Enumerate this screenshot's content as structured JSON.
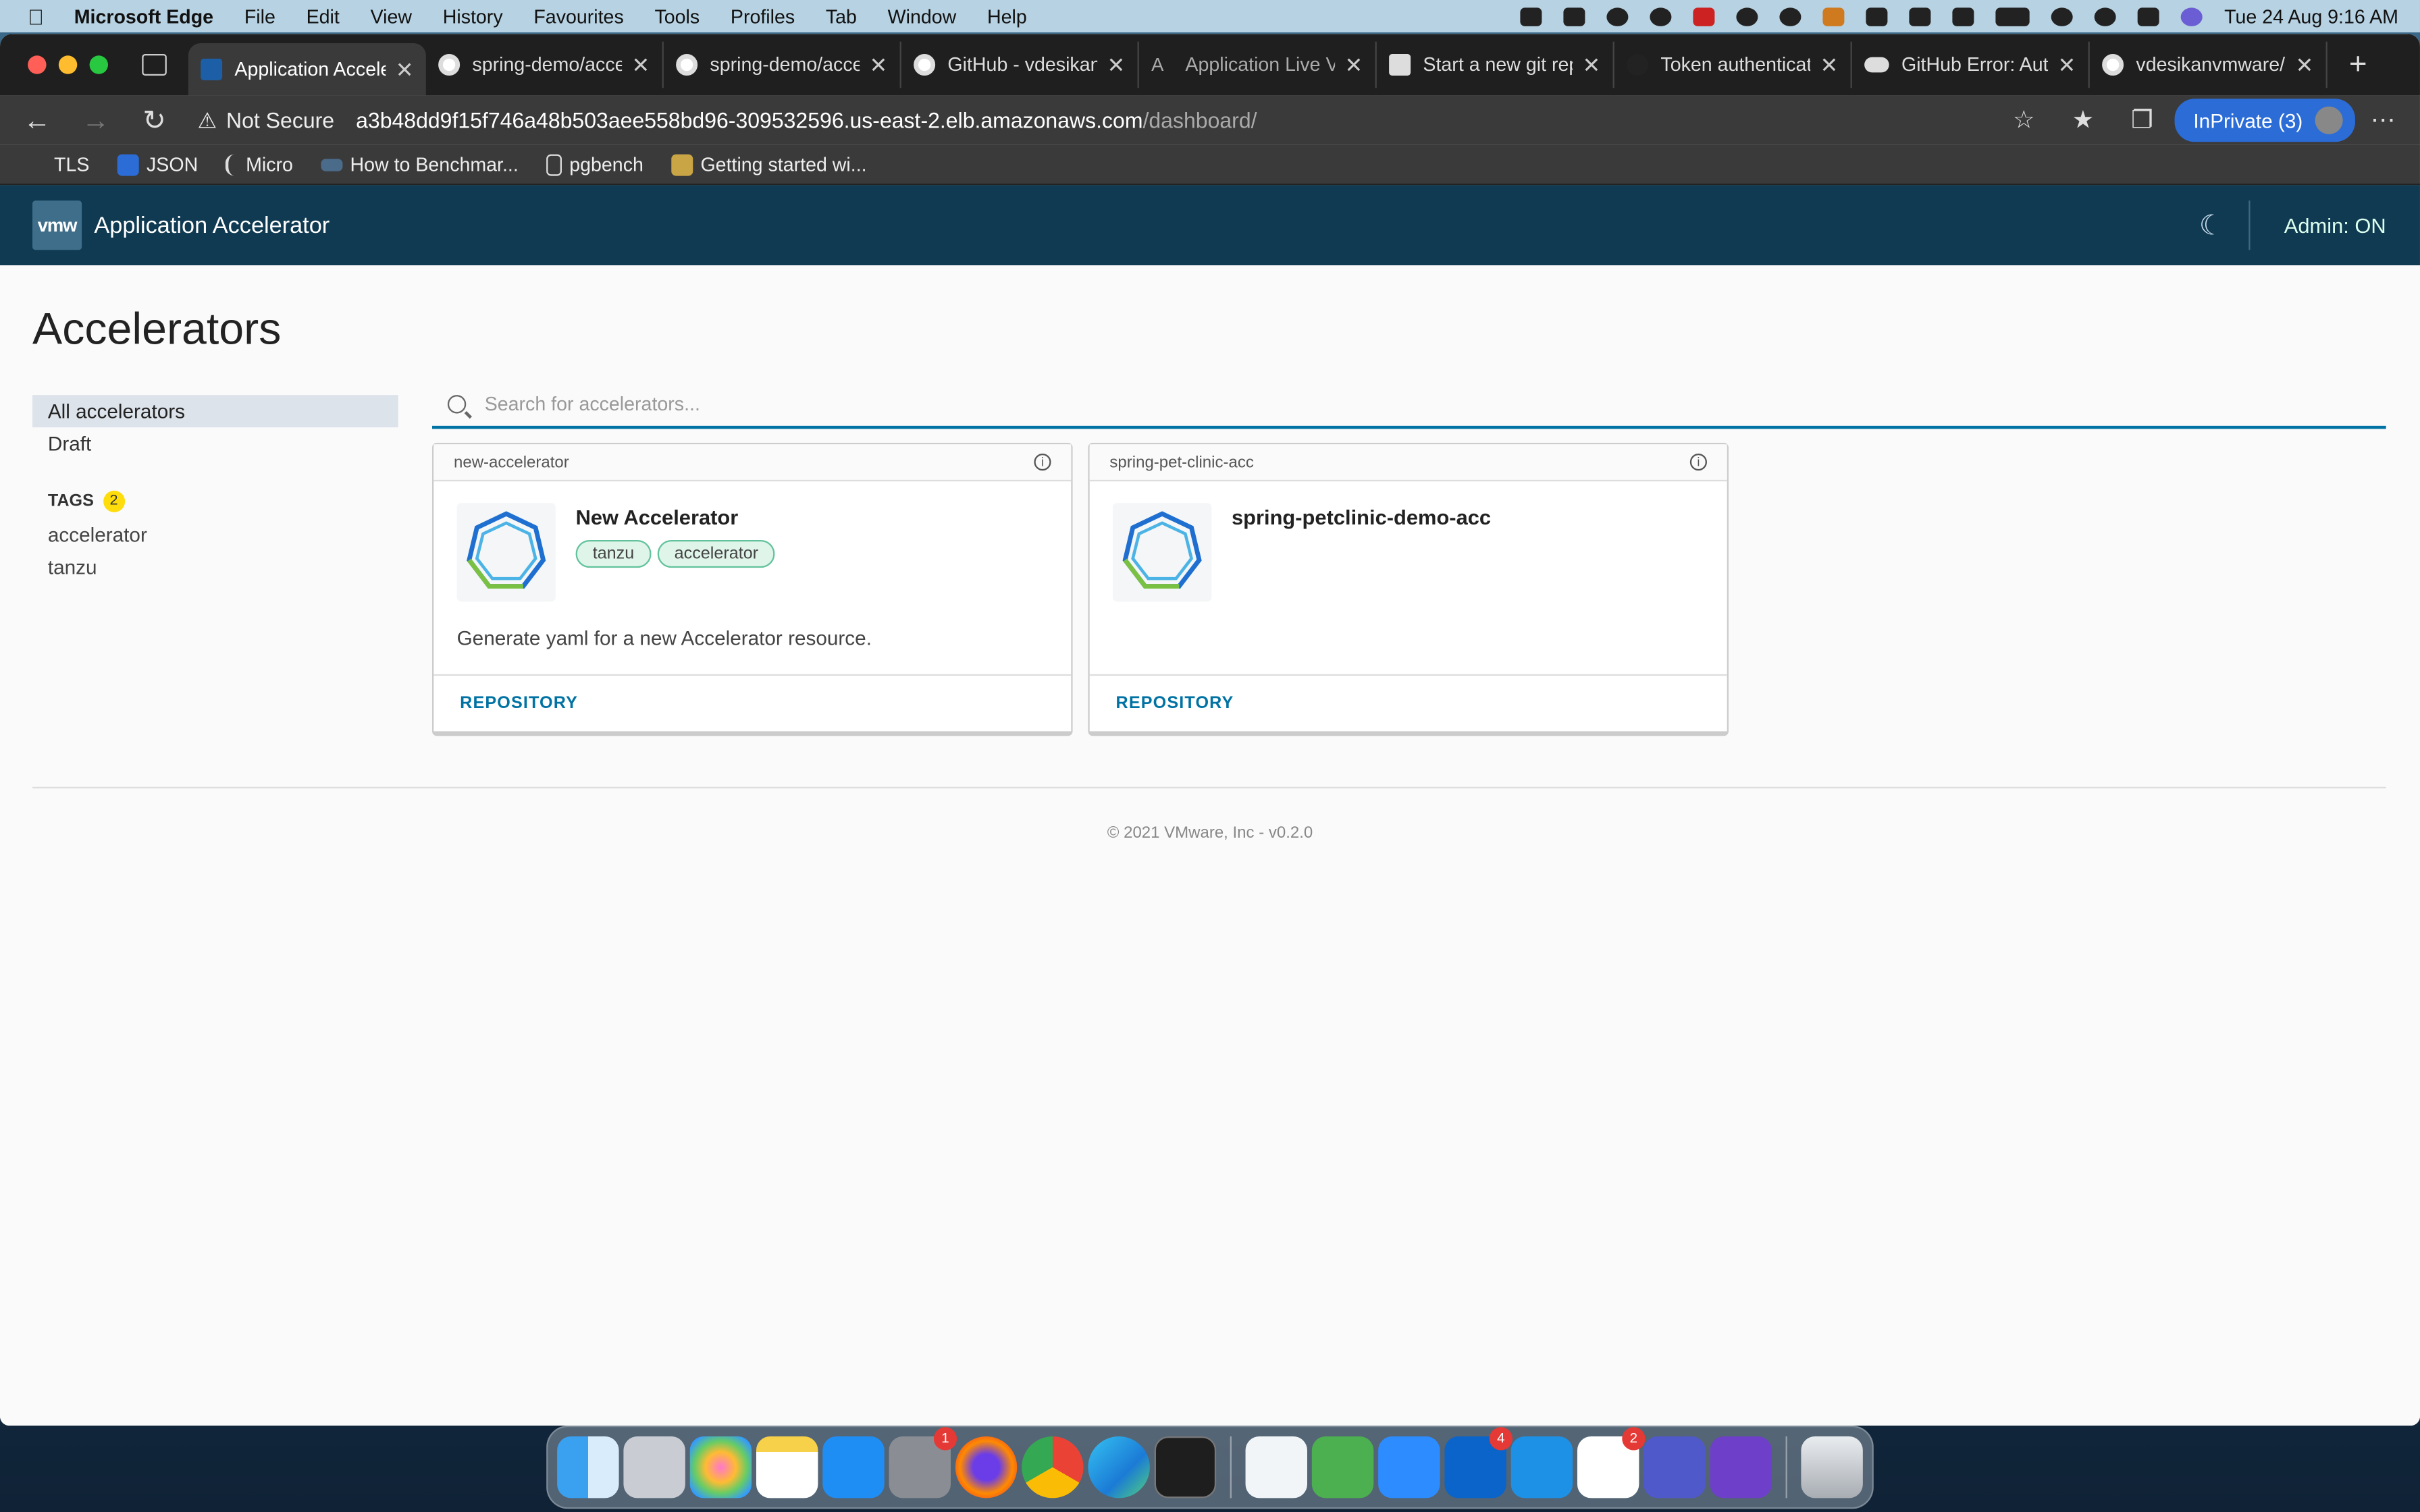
{
  "menubar": {
    "items": [
      "Microsoft Edge",
      "File",
      "Edit",
      "View",
      "History",
      "Favourites",
      "Tools",
      "Profiles",
      "Tab",
      "Window",
      "Help"
    ],
    "clock": "Tue 24 Aug  9:16 AM"
  },
  "tabs": [
    {
      "label": "Application Acceler",
      "active": true
    },
    {
      "label": "spring-demo/accele"
    },
    {
      "label": "spring-demo/accele"
    },
    {
      "label": "GitHub - vdesikanv"
    },
    {
      "label": "Application Live Vie"
    },
    {
      "label": "Start a new git repo"
    },
    {
      "label": "Token authenticatio"
    },
    {
      "label": "GitHub Error: Authe"
    },
    {
      "label": "vdesikanvmware/sp"
    }
  ],
  "toolbar": {
    "not_secure": "Not Secure",
    "url_host": "a3b48dd9f15f746a48b503aee558bd96-309532596.us-east-2.elb.amazonaws.com",
    "url_path": "/dashboard/",
    "inprivate": "InPrivate (3)"
  },
  "bookmarks": [
    "TLS",
    "JSON",
    "Micro",
    "How to Benchmar...",
    "pgbench",
    "Getting started wi..."
  ],
  "app": {
    "logo": "vmw",
    "title": "Application Accelerator",
    "admin": "Admin: ON"
  },
  "page": {
    "title": "Accelerators",
    "sidebar": {
      "items": [
        "All accelerators",
        "Draft"
      ],
      "tags_heading": "TAGS",
      "tags_count": "2",
      "tags": [
        "accelerator",
        "tanzu"
      ]
    },
    "search_placeholder": "Search for accelerators...",
    "cards": [
      {
        "id": "new-accelerator",
        "name": "New Accelerator",
        "tags": [
          "tanzu",
          "accelerator"
        ],
        "description": "Generate yaml for a new Accelerator resource.",
        "link": "REPOSITORY"
      },
      {
        "id": "spring-pet-clinic-acc",
        "name": "spring-petclinic-demo-acc",
        "tags": [],
        "description": "",
        "link": "REPOSITORY"
      }
    ],
    "footer": "© 2021 VMware, Inc - v0.2.0"
  },
  "dock": {
    "badges": {
      "system-preferences": "1",
      "outlook": "4",
      "slack": "2"
    }
  },
  "colors": {
    "header_bg": "#0f3a52",
    "accent": "#0072a3",
    "chip_bg": "#dff5ea",
    "inprivate": "#2b6cd6"
  }
}
